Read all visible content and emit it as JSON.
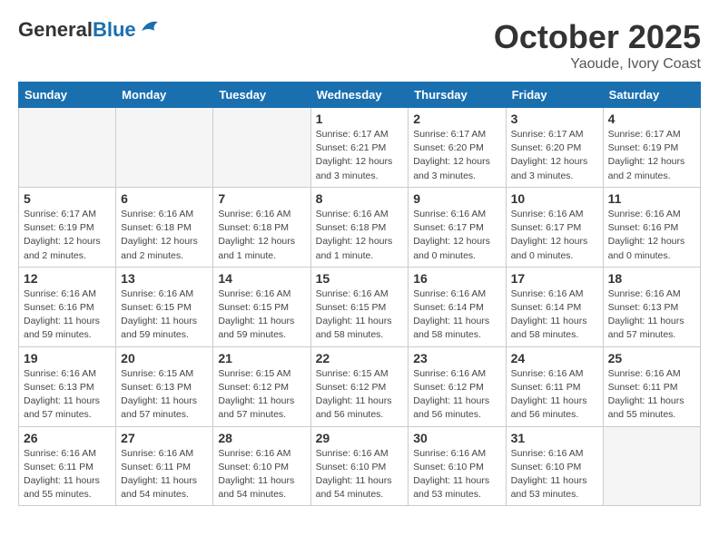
{
  "header": {
    "logo_general": "General",
    "logo_blue": "Blue",
    "month_title": "October 2025",
    "location": "Yaoude, Ivory Coast"
  },
  "weekdays": [
    "Sunday",
    "Monday",
    "Tuesday",
    "Wednesday",
    "Thursday",
    "Friday",
    "Saturday"
  ],
  "weeks": [
    [
      {
        "day": "",
        "info": "",
        "empty": true
      },
      {
        "day": "",
        "info": "",
        "empty": true
      },
      {
        "day": "",
        "info": "",
        "empty": true
      },
      {
        "day": "1",
        "info": "Sunrise: 6:17 AM\nSunset: 6:21 PM\nDaylight: 12 hours\nand 3 minutes.",
        "empty": false
      },
      {
        "day": "2",
        "info": "Sunrise: 6:17 AM\nSunset: 6:20 PM\nDaylight: 12 hours\nand 3 minutes.",
        "empty": false
      },
      {
        "day": "3",
        "info": "Sunrise: 6:17 AM\nSunset: 6:20 PM\nDaylight: 12 hours\nand 3 minutes.",
        "empty": false
      },
      {
        "day": "4",
        "info": "Sunrise: 6:17 AM\nSunset: 6:19 PM\nDaylight: 12 hours\nand 2 minutes.",
        "empty": false
      }
    ],
    [
      {
        "day": "5",
        "info": "Sunrise: 6:17 AM\nSunset: 6:19 PM\nDaylight: 12 hours\nand 2 minutes.",
        "empty": false
      },
      {
        "day": "6",
        "info": "Sunrise: 6:16 AM\nSunset: 6:18 PM\nDaylight: 12 hours\nand 2 minutes.",
        "empty": false
      },
      {
        "day": "7",
        "info": "Sunrise: 6:16 AM\nSunset: 6:18 PM\nDaylight: 12 hours\nand 1 minute.",
        "empty": false
      },
      {
        "day": "8",
        "info": "Sunrise: 6:16 AM\nSunset: 6:18 PM\nDaylight: 12 hours\nand 1 minute.",
        "empty": false
      },
      {
        "day": "9",
        "info": "Sunrise: 6:16 AM\nSunset: 6:17 PM\nDaylight: 12 hours\nand 0 minutes.",
        "empty": false
      },
      {
        "day": "10",
        "info": "Sunrise: 6:16 AM\nSunset: 6:17 PM\nDaylight: 12 hours\nand 0 minutes.",
        "empty": false
      },
      {
        "day": "11",
        "info": "Sunrise: 6:16 AM\nSunset: 6:16 PM\nDaylight: 12 hours\nand 0 minutes.",
        "empty": false
      }
    ],
    [
      {
        "day": "12",
        "info": "Sunrise: 6:16 AM\nSunset: 6:16 PM\nDaylight: 11 hours\nand 59 minutes.",
        "empty": false
      },
      {
        "day": "13",
        "info": "Sunrise: 6:16 AM\nSunset: 6:15 PM\nDaylight: 11 hours\nand 59 minutes.",
        "empty": false
      },
      {
        "day": "14",
        "info": "Sunrise: 6:16 AM\nSunset: 6:15 PM\nDaylight: 11 hours\nand 59 minutes.",
        "empty": false
      },
      {
        "day": "15",
        "info": "Sunrise: 6:16 AM\nSunset: 6:15 PM\nDaylight: 11 hours\nand 58 minutes.",
        "empty": false
      },
      {
        "day": "16",
        "info": "Sunrise: 6:16 AM\nSunset: 6:14 PM\nDaylight: 11 hours\nand 58 minutes.",
        "empty": false
      },
      {
        "day": "17",
        "info": "Sunrise: 6:16 AM\nSunset: 6:14 PM\nDaylight: 11 hours\nand 58 minutes.",
        "empty": false
      },
      {
        "day": "18",
        "info": "Sunrise: 6:16 AM\nSunset: 6:13 PM\nDaylight: 11 hours\nand 57 minutes.",
        "empty": false
      }
    ],
    [
      {
        "day": "19",
        "info": "Sunrise: 6:16 AM\nSunset: 6:13 PM\nDaylight: 11 hours\nand 57 minutes.",
        "empty": false
      },
      {
        "day": "20",
        "info": "Sunrise: 6:15 AM\nSunset: 6:13 PM\nDaylight: 11 hours\nand 57 minutes.",
        "empty": false
      },
      {
        "day": "21",
        "info": "Sunrise: 6:15 AM\nSunset: 6:12 PM\nDaylight: 11 hours\nand 57 minutes.",
        "empty": false
      },
      {
        "day": "22",
        "info": "Sunrise: 6:15 AM\nSunset: 6:12 PM\nDaylight: 11 hours\nand 56 minutes.",
        "empty": false
      },
      {
        "day": "23",
        "info": "Sunrise: 6:16 AM\nSunset: 6:12 PM\nDaylight: 11 hours\nand 56 minutes.",
        "empty": false
      },
      {
        "day": "24",
        "info": "Sunrise: 6:16 AM\nSunset: 6:11 PM\nDaylight: 11 hours\nand 56 minutes.",
        "empty": false
      },
      {
        "day": "25",
        "info": "Sunrise: 6:16 AM\nSunset: 6:11 PM\nDaylight: 11 hours\nand 55 minutes.",
        "empty": false
      }
    ],
    [
      {
        "day": "26",
        "info": "Sunrise: 6:16 AM\nSunset: 6:11 PM\nDaylight: 11 hours\nand 55 minutes.",
        "empty": false
      },
      {
        "day": "27",
        "info": "Sunrise: 6:16 AM\nSunset: 6:11 PM\nDaylight: 11 hours\nand 54 minutes.",
        "empty": false
      },
      {
        "day": "28",
        "info": "Sunrise: 6:16 AM\nSunset: 6:10 PM\nDaylight: 11 hours\nand 54 minutes.",
        "empty": false
      },
      {
        "day": "29",
        "info": "Sunrise: 6:16 AM\nSunset: 6:10 PM\nDaylight: 11 hours\nand 54 minutes.",
        "empty": false
      },
      {
        "day": "30",
        "info": "Sunrise: 6:16 AM\nSunset: 6:10 PM\nDaylight: 11 hours\nand 53 minutes.",
        "empty": false
      },
      {
        "day": "31",
        "info": "Sunrise: 6:16 AM\nSunset: 6:10 PM\nDaylight: 11 hours\nand 53 minutes.",
        "empty": false
      },
      {
        "day": "",
        "info": "",
        "empty": true
      }
    ]
  ]
}
